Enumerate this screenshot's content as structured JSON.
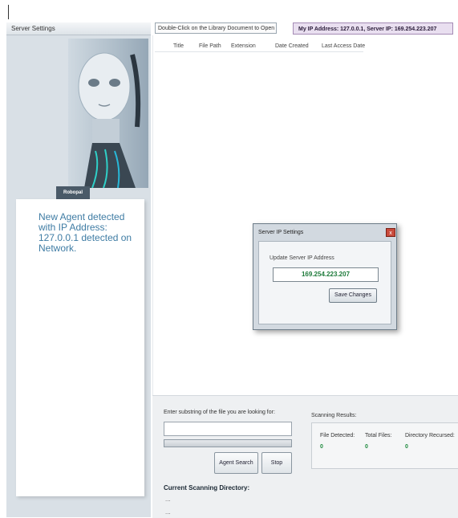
{
  "header": {
    "server_settings_tab": "Server Settings",
    "hint": "Double-Click on the Library Document to Open it.",
    "ip_status": "My IP Address: 127.0.0.1, Server IP: 169.254.223.207"
  },
  "sidebar": {
    "badge": "Robopal",
    "notice": "New Agent detected with IP Address: 127.0.0.1 detected on Network."
  },
  "table": {
    "columns": [
      "Title",
      "File Path",
      "Extension",
      "Date Created",
      "Last Access Date"
    ]
  },
  "dialog": {
    "title": "Server IP Settings",
    "close": "x",
    "label": "Update Server IP Address",
    "ip_value": "169.254.223.207",
    "save_label": "Save Changes"
  },
  "search": {
    "label": "Enter substring of the file you are looking for:",
    "input_value": "",
    "progress": 0,
    "agent_search_label": "Agent Search",
    "stop_label": "Stop",
    "current_dir_label": "Current Scanning Directory:",
    "dir_line1": "...",
    "dir_line2": "..."
  },
  "results": {
    "label": "Scanning Results:",
    "headers": [
      "File Detected:",
      "Total Files:",
      "Directory Recursed:"
    ],
    "values": [
      "0",
      "0",
      "0"
    ]
  },
  "colors": {
    "notice_text": "#3f7ca4",
    "ip_text": "#1d7a3a",
    "close_button": "#c94a3b"
  }
}
